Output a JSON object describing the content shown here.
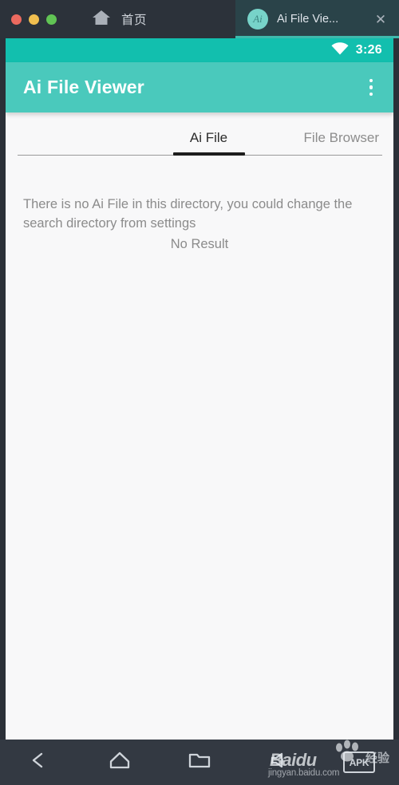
{
  "window": {
    "traffic_lights": [
      "close",
      "minimize",
      "maximize"
    ],
    "home_tab": {
      "label": "首页",
      "icon": "home-icon"
    },
    "app_tab": {
      "title": "Ai File Vie...",
      "favicon_text": "Ai",
      "close_label": "✕"
    }
  },
  "statusbar": {
    "wifi_icon": "wifi-icon",
    "time": "3:26",
    "background": "#12bfae"
  },
  "appbar": {
    "title": "Ai File Viewer",
    "overflow_icon": "more-vertical-icon",
    "background": "#4ac9bc"
  },
  "tabs": {
    "items": [
      {
        "label": "Ai File",
        "active": true
      },
      {
        "label": "File Browser",
        "active": false
      }
    ],
    "indicator_color": "#1d1d1d"
  },
  "content": {
    "empty_message": "There is no Ai File in this directory, you could change the search directory from settings",
    "no_result": "No Result"
  },
  "navbar": {
    "items": [
      {
        "name": "back-icon",
        "label": ""
      },
      {
        "name": "home-icon",
        "label": ""
      },
      {
        "name": "folder-icon",
        "label": ""
      },
      {
        "name": "volume-icon",
        "label": ""
      },
      {
        "name": "apk-install-icon",
        "label": "APK"
      }
    ]
  },
  "watermark": {
    "brand": "Baidu",
    "brand_cn": "经验",
    "url": "jingyan.baidu.com"
  }
}
